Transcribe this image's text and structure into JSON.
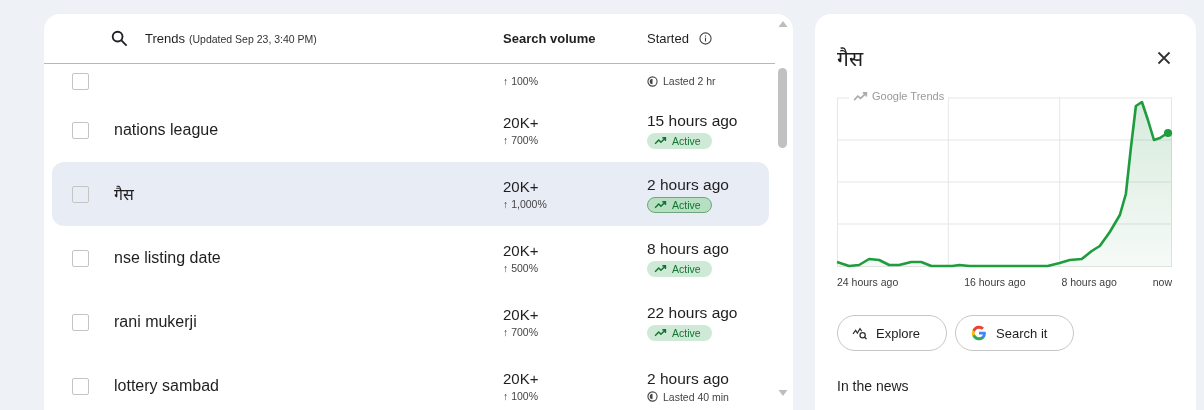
{
  "header": {
    "title": "Trends",
    "updated": "(Updated Sep 23, 3:40 PM)",
    "volume_column": "Search volume",
    "started_column": "Started"
  },
  "rows": [
    {
      "checked": false,
      "selected": false,
      "change": "↑ 100%",
      "status": {
        "kind": "lasted",
        "text": "Lasted 2 hr"
      }
    },
    {
      "checked": false,
      "selected": false,
      "title": "nations league",
      "volume": "20K+",
      "change": "↑ 700%",
      "started": "15 hours ago",
      "status": {
        "kind": "active",
        "text": "Active"
      }
    },
    {
      "checked": false,
      "selected": true,
      "title": "गैस",
      "volume": "20K+",
      "change": "↑ 1,000%",
      "started": "2 hours ago",
      "status": {
        "kind": "active",
        "text": "Active"
      }
    },
    {
      "checked": false,
      "selected": false,
      "title": "nse listing date",
      "volume": "20K+",
      "change": "↑ 500%",
      "started": "8 hours ago",
      "status": {
        "kind": "active",
        "text": "Active"
      }
    },
    {
      "checked": false,
      "selected": false,
      "title": "rani mukerji",
      "volume": "20K+",
      "change": "↑ 700%",
      "started": "22 hours ago",
      "status": {
        "kind": "active",
        "text": "Active"
      }
    },
    {
      "checked": false,
      "selected": false,
      "title": "lottery sambad",
      "volume": "20K+",
      "change": "↑ 100%",
      "started": "2 hours ago",
      "status": {
        "kind": "lasted",
        "text": "Lasted 40 min"
      }
    }
  ],
  "detail": {
    "title": "गैस",
    "chart": {
      "brand": "Google Trends",
      "x_labels": [
        "24 hours ago",
        "16 hours ago",
        "8 hours ago",
        "now"
      ]
    },
    "buttons": [
      {
        "kind": "explore",
        "label": "Explore"
      },
      {
        "kind": "search",
        "label": "Search it"
      }
    ],
    "section": "In the news"
  }
}
